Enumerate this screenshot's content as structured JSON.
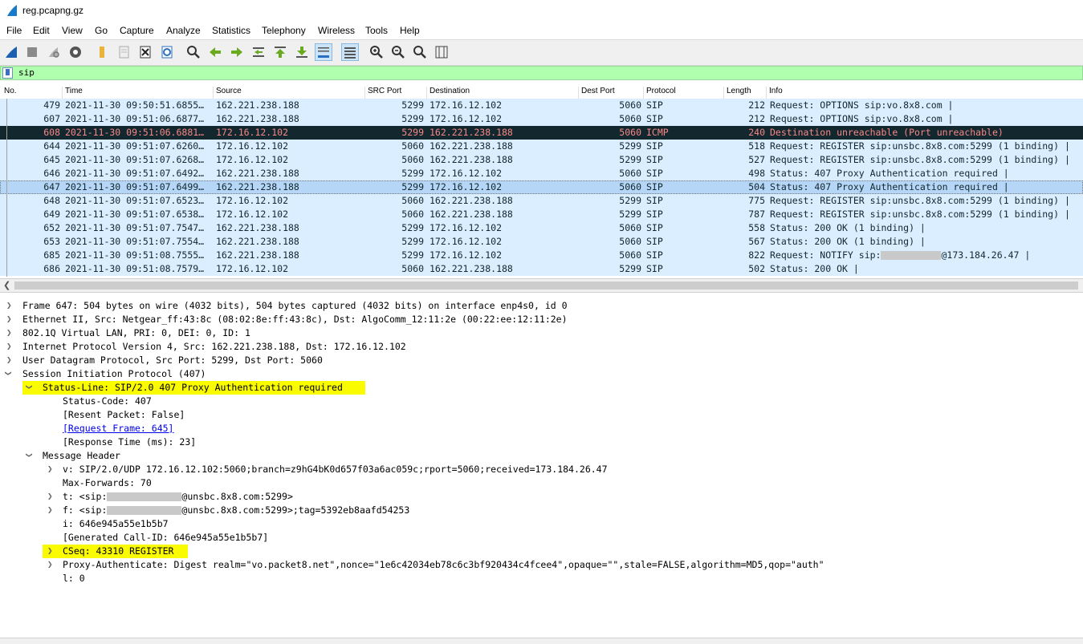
{
  "window": {
    "title": "reg.pcapng.gz"
  },
  "menu": [
    "File",
    "Edit",
    "View",
    "Go",
    "Capture",
    "Analyze",
    "Statistics",
    "Telephony",
    "Wireless",
    "Tools",
    "Help"
  ],
  "toolbar": {
    "icons": [
      "shark-fin-icon",
      "stop-icon",
      "restart-icon",
      "options-gear-icon",
      "open-folder-icon",
      "save-icon",
      "close-file-icon",
      "reload-icon",
      "find-icon",
      "go-back-icon",
      "go-forward-icon",
      "go-to-packet-icon",
      "first-packet-icon",
      "last-packet-icon",
      "autoscroll-icon",
      "colorize-icon",
      "zoom-in-icon",
      "zoom-out-icon",
      "zoom-normal-icon",
      "resize-columns-icon"
    ]
  },
  "filter": {
    "value": "sip"
  },
  "columns": [
    "No.",
    "Time",
    "Source",
    "SRC Port",
    "Destination",
    "Dest Port",
    "Protocol",
    "Length",
    "Info"
  ],
  "packets": [
    {
      "no": "479",
      "time": "2021-11-30 09:50:51.6855…",
      "src": "162.221.238.188",
      "sport": "5299",
      "dst": "172.16.12.102",
      "dport": "5060",
      "proto": "SIP",
      "len": "212",
      "info": "Request: OPTIONS sip:vo.8x8.com  |"
    },
    {
      "no": "607",
      "time": "2021-11-30 09:51:06.6877…",
      "src": "162.221.238.188",
      "sport": "5299",
      "dst": "172.16.12.102",
      "dport": "5060",
      "proto": "SIP",
      "len": "212",
      "info": "Request: OPTIONS sip:vo.8x8.com  |"
    },
    {
      "no": "608",
      "time": "2021-11-30 09:51:06.6881…",
      "src": "172.16.12.102",
      "sport": "5299",
      "dst": "162.221.238.188",
      "dport": "5060",
      "proto": "ICMP",
      "len": "240",
      "info": "Destination unreachable (Port unreachable)"
    },
    {
      "no": "644",
      "time": "2021-11-30 09:51:07.6260…",
      "src": "172.16.12.102",
      "sport": "5060",
      "dst": "162.221.238.188",
      "dport": "5299",
      "proto": "SIP",
      "len": "518",
      "info": "Request: REGISTER sip:unsbc.8x8.com:5299  (1 binding) |"
    },
    {
      "no": "645",
      "time": "2021-11-30 09:51:07.6268…",
      "src": "172.16.12.102",
      "sport": "5060",
      "dst": "162.221.238.188",
      "dport": "5299",
      "proto": "SIP",
      "len": "527",
      "info": "Request: REGISTER sip:unsbc.8x8.com:5299  (1 binding) |"
    },
    {
      "no": "646",
      "time": "2021-11-30 09:51:07.6492…",
      "src": "162.221.238.188",
      "sport": "5299",
      "dst": "172.16.12.102",
      "dport": "5060",
      "proto": "SIP",
      "len": "498",
      "info": "Status: 407 Proxy Authentication required |"
    },
    {
      "no": "647",
      "time": "2021-11-30 09:51:07.6499…",
      "src": "162.221.238.188",
      "sport": "5299",
      "dst": "172.16.12.102",
      "dport": "5060",
      "proto": "SIP",
      "len": "504",
      "info": "Status: 407 Proxy Authentication required |"
    },
    {
      "no": "648",
      "time": "2021-11-30 09:51:07.6523…",
      "src": "172.16.12.102",
      "sport": "5060",
      "dst": "162.221.238.188",
      "dport": "5299",
      "proto": "SIP",
      "len": "775",
      "info": "Request: REGISTER sip:unsbc.8x8.com:5299  (1 binding) |"
    },
    {
      "no": "649",
      "time": "2021-11-30 09:51:07.6538…",
      "src": "172.16.12.102",
      "sport": "5060",
      "dst": "162.221.238.188",
      "dport": "5299",
      "proto": "SIP",
      "len": "787",
      "info": "Request: REGISTER sip:unsbc.8x8.com:5299  (1 binding) |"
    },
    {
      "no": "652",
      "time": "2021-11-30 09:51:07.7547…",
      "src": "162.221.238.188",
      "sport": "5299",
      "dst": "172.16.12.102",
      "dport": "5060",
      "proto": "SIP",
      "len": "558",
      "info": "Status: 200 OK  (1 binding) |"
    },
    {
      "no": "653",
      "time": "2021-11-30 09:51:07.7554…",
      "src": "162.221.238.188",
      "sport": "5299",
      "dst": "172.16.12.102",
      "dport": "5060",
      "proto": "SIP",
      "len": "567",
      "info": "Status: 200 OK  (1 binding) |"
    },
    {
      "no": "685",
      "time": "2021-11-30 09:51:08.7555…",
      "src": "162.221.238.188",
      "sport": "5299",
      "dst": "172.16.12.102",
      "dport": "5060",
      "proto": "SIP",
      "len": "822",
      "info_pre": "Request: NOTIFY sip:",
      "info_post": "@173.184.26.47  |"
    },
    {
      "no": "686",
      "time": "2021-11-30 09:51:08.7579…",
      "src": "172.16.12.102",
      "sport": "5060",
      "dst": "162.221.238.188",
      "dport": "5299",
      "proto": "SIP",
      "len": "502",
      "info": "Status: 200 OK |"
    }
  ],
  "details": {
    "frame": "Frame 647: 504 bytes on wire (4032 bits), 504 bytes captured (4032 bits) on interface enp4s0, id 0",
    "ethernet": "Ethernet II, Src: Netgear_ff:43:8c (08:02:8e:ff:43:8c), Dst: AlgoComm_12:11:2e (00:22:ee:12:11:2e)",
    "vlan": "802.1Q Virtual LAN, PRI: 0, DEI: 0, ID: 1",
    "ip": "Internet Protocol Version 4, Src: 162.221.238.188, Dst: 172.16.12.102",
    "udp": "User Datagram Protocol, Src Port: 5299, Dst Port: 5060",
    "sip": "Session Initiation Protocol (407)",
    "status_line": "Status-Line: SIP/2.0 407 Proxy Authentication required",
    "status_code": "Status-Code: 407",
    "resent": "[Resent Packet: False]",
    "request_frame": "[Request Frame: 645]",
    "response_time": "[Response Time (ms): 23]",
    "message_header": "Message Header",
    "via": "v: SIP/2.0/UDP 172.16.12.102:5060;branch=z9hG4bK0d657f03a6ac059c;rport=5060;received=173.184.26.47",
    "max_forwards": "Max-Forwards: 70",
    "to_pre": "t: <sip:",
    "to_post": "@unsbc.8x8.com:5299>",
    "from_pre": "f: <sip:",
    "from_post": "@unsbc.8x8.com:5299>;tag=5392eb8aafd54253",
    "call_id": "i: 646e945a55e1b5b7",
    "gen_call_id": "[Generated Call-ID: 646e945a55e1b5b7]",
    "cseq": "CSeq: 43310 REGISTER",
    "proxy_auth": "Proxy-Authenticate: Digest realm=\"vo.packet8.net\",nonce=\"1e6c42034eb78c6c3bf920434c4fcee4\",opaque=\"\",stale=FALSE,algorithm=MD5,qop=\"auth\"",
    "content_length": "l: 0"
  },
  "colors": {
    "row_bg": "#daeeff",
    "row_selected": "#b5d6f6",
    "icmp_bg": "#12272e",
    "icmp_fg": "#f78787",
    "highlight": "#fbfb00",
    "filter_bg": "#afffaf"
  }
}
